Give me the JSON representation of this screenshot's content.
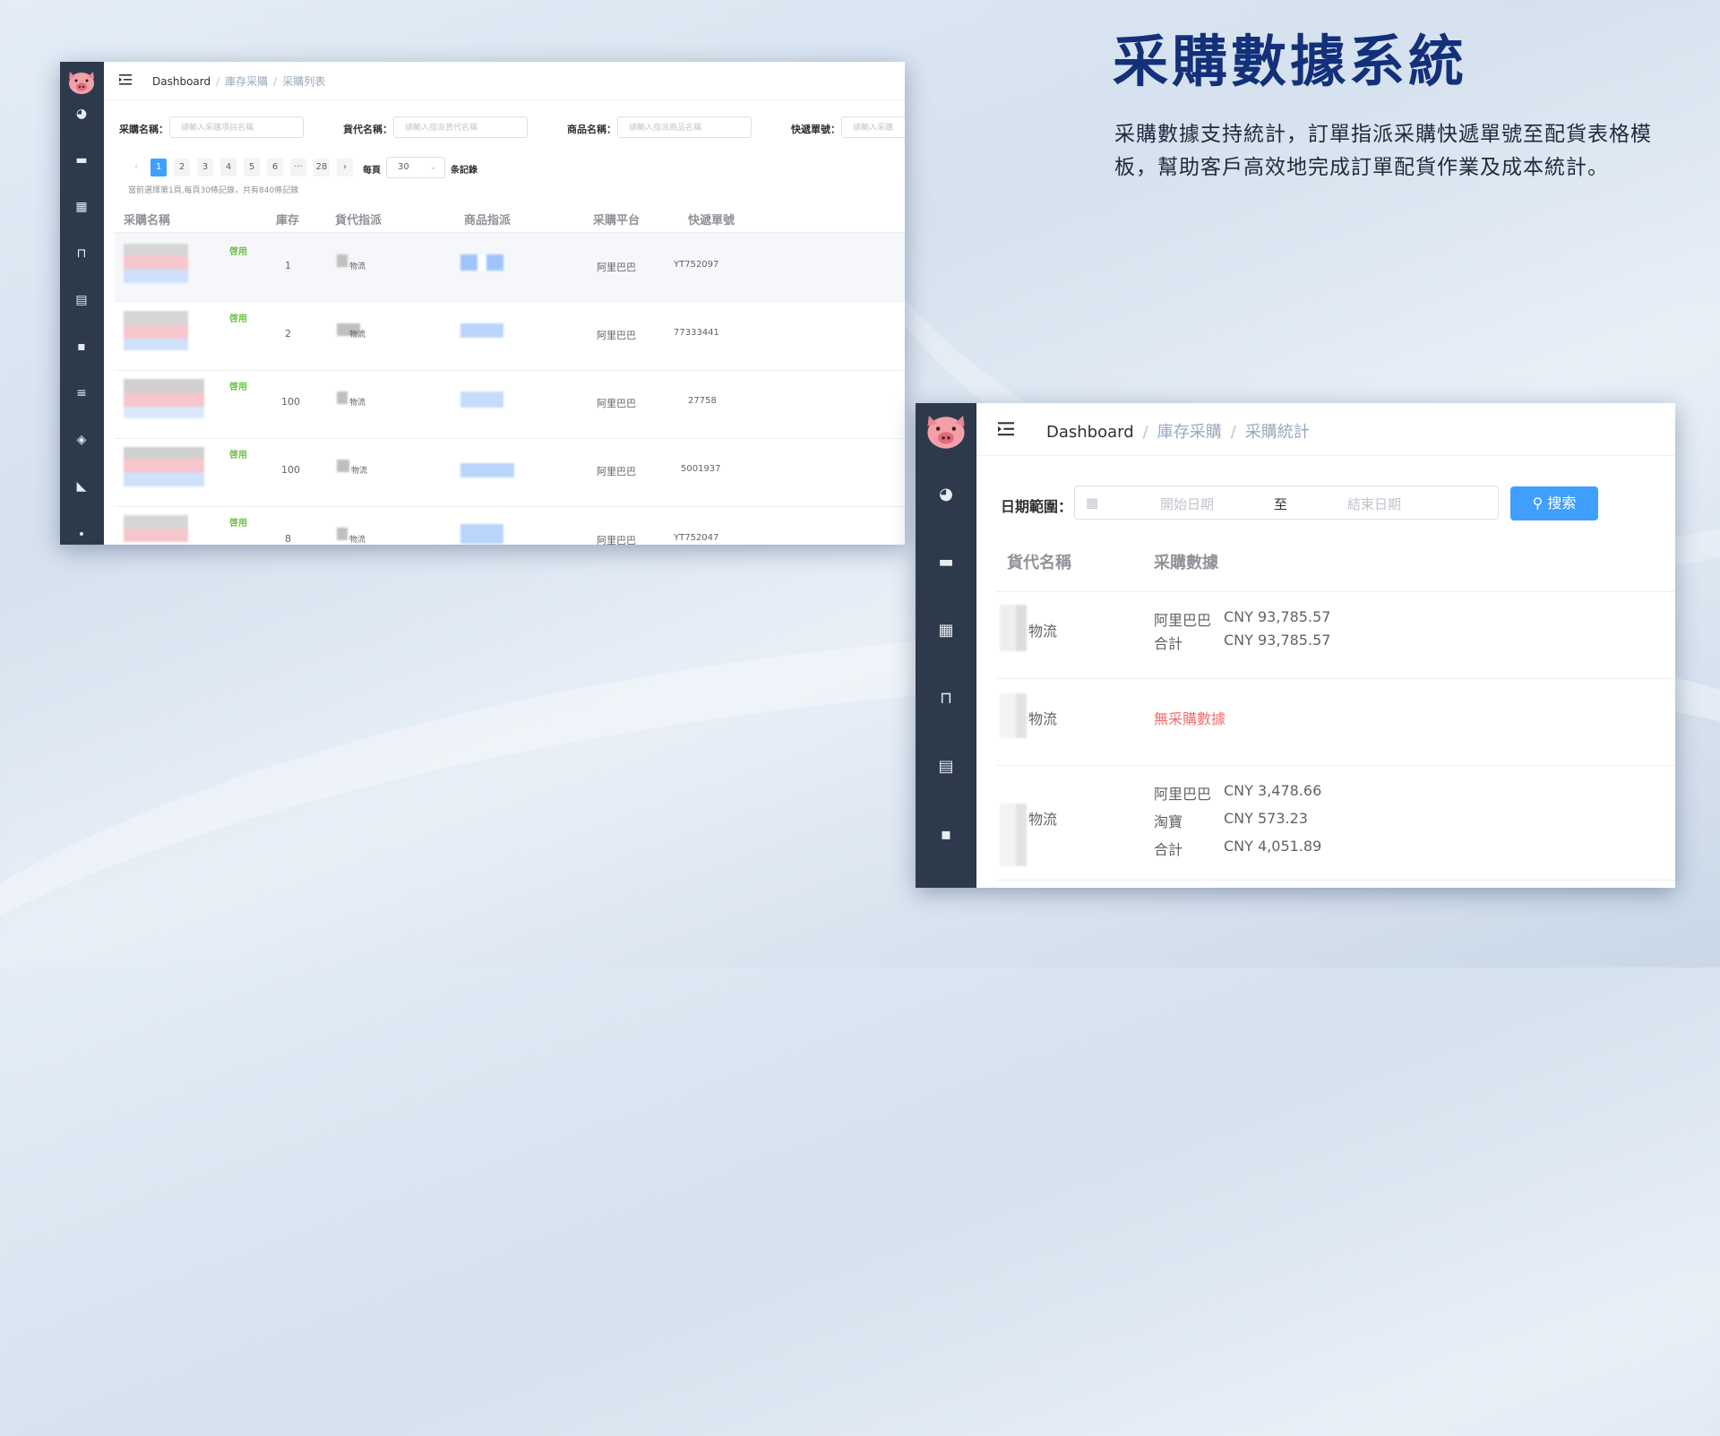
{
  "headline": {
    "title": "采購數據系統",
    "desc": "采購數據支持統計，訂單指派采購快遞單號至配貨表格模板，幫助客戶高效地完成訂單配貨作業及成本統計。"
  },
  "list_view": {
    "breadcrumb": [
      "Dashboard",
      "庫存采購",
      "采購列表"
    ],
    "filters": [
      {
        "label": "采購名稱：",
        "placeholder": "請輸入采購項目名稱"
      },
      {
        "label": "貨代名稱：",
        "placeholder": "請輸入指派貨代名稱"
      },
      {
        "label": "商品名稱：",
        "placeholder": "請輸入指派商品名稱"
      },
      {
        "label": "快遞單號：",
        "placeholder": "請輸入采購"
      }
    ],
    "pagination": {
      "pages": [
        "1",
        "2",
        "3",
        "4",
        "5",
        "6",
        "···",
        "28"
      ],
      "current": "1",
      "per_page_label": "每頁",
      "per_page_value": "30",
      "records_label": "条記錄",
      "summary": "當前選擇第1頁,每頁30條記錄，共有840條記錄"
    },
    "columns": [
      "采購名稱",
      "庫存",
      "貨代指派",
      "商品指派",
      "采購平台",
      "快遞單號"
    ],
    "rows": [
      {
        "status": "啓用",
        "stock": "1",
        "forwarder": "物流",
        "platform": "阿里巴巴",
        "tracking": "YT752097"
      },
      {
        "status": "啓用",
        "stock": "2",
        "forwarder": "物流",
        "platform": "阿里巴巴",
        "tracking": "77333441"
      },
      {
        "status": "啓用",
        "stock": "100",
        "forwarder": "物流",
        "platform": "阿里巴巴",
        "tracking": "27758"
      },
      {
        "status": "啓用",
        "stock": "100",
        "forwarder": "物流",
        "platform": "阿里巴巴",
        "tracking": "5001937"
      },
      {
        "status": "啓用",
        "stock": "8",
        "forwarder": "物流",
        "platform": "阿里巴巴",
        "tracking": "YT752047"
      }
    ]
  },
  "stats_view": {
    "breadcrumb": [
      "Dashboard",
      "庫存采購",
      "采購統計"
    ],
    "date_label": "日期範圍：",
    "start_placeholder": "開始日期",
    "range_sep": "至",
    "end_placeholder": "結束日期",
    "search_label": "搜索",
    "columns": [
      "貨代名稱",
      "采購數據"
    ],
    "rows": [
      {
        "name": "物流",
        "lines": [
          {
            "k": "阿里巴巴",
            "v": "CNY 93,785.57"
          },
          {
            "k": "合計",
            "v": "CNY 93,785.57"
          }
        ]
      },
      {
        "name": "物流",
        "nodata": "無采購數據"
      },
      {
        "name": "物流",
        "lines": [
          {
            "k": "阿里巴巴",
            "v": "CNY 3,478.66"
          },
          {
            "k": "淘寶",
            "v": "CNY 573.23"
          },
          {
            "k": "合計",
            "v": "CNY 4,051.89"
          }
        ]
      }
    ]
  },
  "colors": {
    "sidebar": "#2d3a4b",
    "accent": "#409eff",
    "title": "#13307a",
    "enabled": "#67c23a",
    "nodata": "#f56c6c"
  },
  "icons": [
    "pig-logo-icon",
    "dashboard-icon",
    "inbox-icon",
    "grid-icon",
    "shopping-bag-icon",
    "clipboard-icon",
    "message-icon",
    "list-icon",
    "box-icon",
    "megaphone-icon",
    "menu-fold-icon",
    "search-icon",
    "calendar-icon"
  ]
}
